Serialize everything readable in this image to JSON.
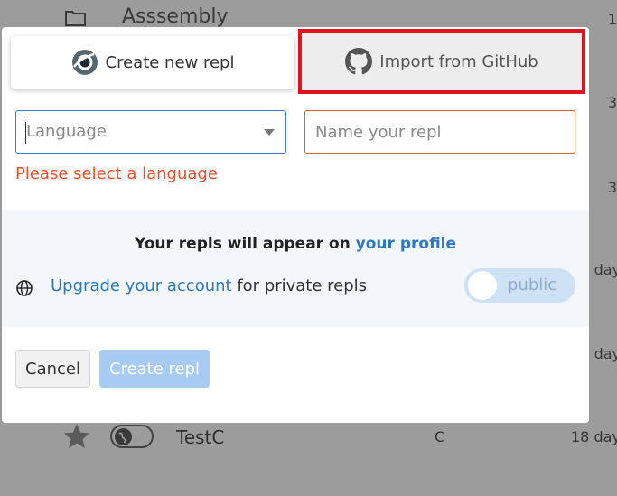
{
  "background": {
    "folder_title": "Asssembly",
    "right_edge_texts": [
      "1",
      "3",
      "3",
      "day",
      "day"
    ],
    "row": {
      "name": "TestC",
      "language": "C",
      "date": "18 day"
    }
  },
  "modal": {
    "tabs": {
      "create_label": "Create new repl",
      "import_label": "Import from GitHub"
    },
    "language_select": {
      "placeholder": "Language"
    },
    "name_input": {
      "placeholder": "Name your repl"
    },
    "error_text": "Please select a language",
    "info": {
      "headline_prefix": "Your repls will appear on",
      "headline_link": "your profile",
      "upgrade_link": "Upgrade your account",
      "upgrade_suffix": "for private repls",
      "visibility_label": "public"
    },
    "buttons": {
      "cancel": "Cancel",
      "create": "Create repl"
    }
  },
  "colors": {
    "accent_blue": "#2d78c0",
    "error_red": "#e8502b",
    "highlight_red": "#e0141e",
    "create_button_disabled": "#a7cbf3"
  }
}
